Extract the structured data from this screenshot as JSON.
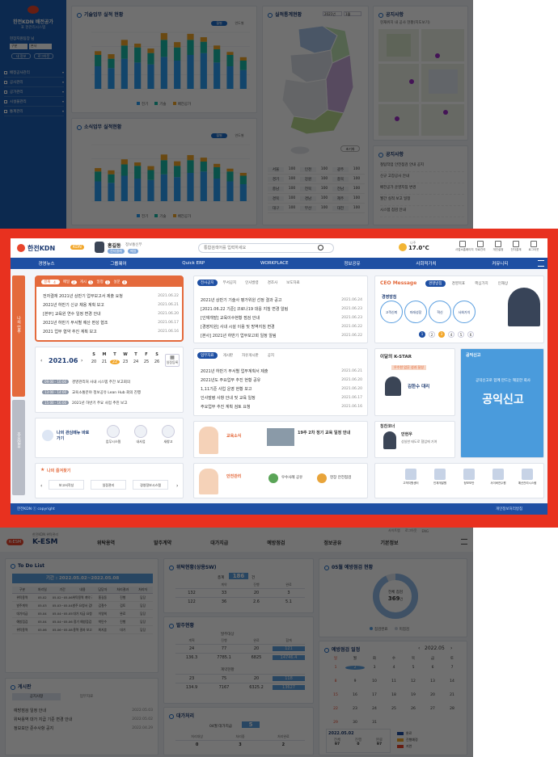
{
  "top": {
    "logo": "한전KDN 배전공가",
    "sub": "표 현관리시스템",
    "user": "현장지원팀장 님",
    "sel1": "구분",
    "sel2": "본사",
    "btn1": "내 정보",
    "btn2": "로그아웃",
    "menu": [
      "배정공사관리",
      "공사관리",
      "공가관리",
      "시설물관리",
      "통계관리"
    ],
    "chart1_title": "기술업무 실적 현황",
    "chart2_title": "소식업무 실적현황",
    "toggle_on": "월별",
    "toggle_off": "연도별",
    "legend": [
      "전기",
      "기술",
      "배전공가"
    ],
    "map_title": "실적통계현황",
    "map_year": "2021년",
    "map_month": "1월",
    "map_btn": "초기화",
    "map_table": [
      [
        "서울",
        "100",
        "인천",
        "100",
        "광주",
        "100"
      ],
      [
        "경기",
        "100",
        "강원",
        "100",
        "충북",
        "100"
      ],
      [
        "충남",
        "100",
        "전북",
        "100",
        "전남",
        "100"
      ],
      [
        "경북",
        "100",
        "경남",
        "100",
        "제주",
        "100"
      ],
      [
        "대구",
        "100",
        "부산",
        "100",
        "대전",
        "100"
      ]
    ],
    "loc_title": "공지사항",
    "loc_note": "현재위치 내 공사 현황(지도보기)",
    "notice_title": "공지사항",
    "notices": [
      "철탑작업 안전점검 안내 공지",
      "신규 고장공사 안내",
      "배전공가 운영지침 변경",
      "월간 실적 보고 일정",
      "시스템 점검 안내"
    ],
    "chart_data": [
      {
        "type": "bar",
        "title": "기술업무 실적 현황",
        "series": [
          {
            "name": "전기",
            "values": [
              60,
              55,
              80,
              70,
              65,
              85,
              75,
              90,
              95,
              70,
              60,
              50
            ]
          },
          {
            "name": "기술",
            "values": [
              30,
              25,
              35,
              40,
              30,
              45,
              35,
              40,
              30,
              35,
              30,
              25
            ]
          },
          {
            "name": "배전공가",
            "values": [
              10,
              12,
              15,
              10,
              12,
              18,
              14,
              16,
              12,
              10,
              8,
              9
            ]
          }
        ]
      },
      {
        "type": "bar",
        "title": "소식업무 실적현황",
        "series": [
          {
            "name": "전기",
            "values": [
              70,
              65,
              90,
              80,
              75,
              95,
              85,
              100,
              105,
              80,
              70,
              60
            ]
          },
          {
            "name": "기술",
            "values": [
              35,
              30,
              40,
              45,
              35,
              50,
              40,
              45,
              35,
              40,
              35,
              30
            ]
          },
          {
            "name": "배전공가",
            "values": [
              12,
              14,
              18,
              12,
              14,
              20,
              16,
              18,
              14,
              12,
              10,
              10
            ]
          }
        ]
      }
    ]
  },
  "portal": {
    "logo": "한전KDN",
    "logo_badge": "KDN",
    "user_name": "홍길동",
    "user_dept": "정보통신부",
    "user_tag1": "전자결재",
    "user_tag2": "메일",
    "search_placeholder": "통합검색어를 입력하세요",
    "weather_temp": "17.0℃",
    "weather_city": "나주",
    "tools": [
      "사업소홈페이지",
      "자료관리",
      "개인설정",
      "전자결재",
      "로그아웃"
    ],
    "nav": [
      "경영뉴스",
      "그룹웨어",
      "Quick ERP",
      "WORKPLACE",
      "정보공유",
      "사회적가치",
      "커뮤니티"
    ],
    "side_tabs": [
      "나의 업무",
      "주요업무"
    ],
    "mail_tabs": [
      "결재",
      "메일",
      "게시",
      "일정",
      "설문"
    ],
    "mail_counts": [
      "4",
      "2",
      "5",
      "1",
      "0"
    ],
    "mail_items": [
      {
        "t": "전자결재 2021년 상반기 업무보고서 제출 요청",
        "d": "2021.06.22"
      },
      {
        "t": "2021년 하반기 신규 채용 계획 보고",
        "d": "2021.06.21"
      },
      {
        "t": "[본부] 교육원 연수 일정 변경 안내",
        "d": "2021.06.20"
      },
      {
        "t": "2021년 하반기 부서별 예산 편성 협조",
        "d": "2021.06.17"
      },
      {
        "t": "2021 업무 협약 추진 계획 보고",
        "d": "2021.06.16"
      }
    ],
    "cal_month": "2021.06",
    "cal_days": [
      "S",
      "M",
      "T",
      "W",
      "T",
      "F",
      "S"
    ],
    "cal_dates": [
      "20",
      "21",
      "22",
      "23",
      "24",
      "25",
      "26"
    ],
    "cal_btn": "일정등록",
    "sched": [
      {
        "tag": "09:00 - 10:00",
        "t": "경영관리처 사내 시스템 주간 보고회의"
      },
      {
        "tag": "13:00 - 14:00",
        "t": "교육소통분야 정보공유 Lean Hub 회의 진행"
      },
      {
        "tag": "15:00 - 16:00",
        "t": "2021년 하반기 주요 사업 추진 보고"
      }
    ],
    "qm_title": "나의 관심메뉴 바로가기",
    "qm_items": [
      "업무시스템",
      "내사업",
      "새창고"
    ],
    "fav_title": "나의 즐겨찾기",
    "fav_items": [
      "보고서작성",
      "일정관리",
      "경영정보시스템"
    ],
    "news_tabs": [
      "전사공지",
      "부서공지",
      "인사발령",
      "경조사",
      "보도자료"
    ],
    "news_items": [
      {
        "t": "2021년 상반기 기술사 평가위원 선정 결과 공고",
        "d": "2021.06.24"
      },
      {
        "t": "[2021.06.22 기준] 코로나19 대응 지침 변경 알림",
        "d": "2021.06.23"
      },
      {
        "t": "[인재개발] 교육이수현황 점검 안내",
        "d": "2021.06.23"
      },
      {
        "t": "[경영지원] 사내 시설 이용 및 방역지침 변경",
        "d": "2021.06.22"
      },
      {
        "t": "[본사] 2021년 하반기 업무보고회 일정 알림",
        "d": "2021.06.22"
      }
    ],
    "news2_tabs": [
      "업무자료",
      "게시판",
      "자유게시판",
      "공지"
    ],
    "news2_items": [
      {
        "t": "2021년 하반기 부서별 업무계획서 제출",
        "d": "2021.06.21"
      },
      {
        "t": "2021년도 주요업무 추진 현황 공유",
        "d": "2021.06.20"
      },
      {
        "t": "1,11기준 사업 운영 현황 보고",
        "d": "2021.06.20"
      },
      {
        "t": "인사발령 사항 안내 및 교육 일정",
        "d": "2021.06.17"
      },
      {
        "t": "주요업무 추진 계획 검토 요청",
        "d": "2021.06.16"
      }
    ],
    "ceo_title": "CEO Message",
    "ceo_tabs": [
      "경영방침",
      "경영목표",
      "핵심가치",
      "인재상"
    ],
    "ceo_circles": [
      "고객신뢰",
      "미래성장",
      "혁신",
      "사회가치"
    ],
    "ceo_label": "경영방침",
    "ceo_pages": [
      "1",
      "2",
      "3",
      "4",
      "5",
      "6"
    ],
    "kstar_title": "이달의 K-STAR",
    "kstar_caption": "우수한 업무 성과 달성",
    "kstar_name": "김한수 대리",
    "pr_title": "칭찬코너",
    "pr_name": "안현우",
    "pr_text": "성실한 태도로 협업에 기여",
    "side_title": "공익신고",
    "side_sub": "공익신고로 함께 만드는 깨끗한 회사",
    "side_big": "공익신고",
    "banner1_label": "교육소식",
    "banner1_text": "19주 2차 정기 교육 일정 안내",
    "banner2_label": "안전관리",
    "banner2_items": [
      "우수사례 공유",
      "현장 안전점검"
    ],
    "bottom_icons": [
      "고객지원센터",
      "인재개발원",
      "정보보안",
      "사이버연수원",
      "예산관리시스템"
    ],
    "footer_left": "한전KDN ⓒ copyright",
    "footer_right": "개인정보처리방침"
  },
  "esm": {
    "brand": "K-ESM",
    "brand_sub": "한전KDN 위탁관리",
    "util": [
      "사이트맵",
      "로그아웃",
      "ENG"
    ],
    "nav": [
      "위탁용역",
      "발주계약",
      "대가지급",
      "예방점검",
      "정보공유",
      "기본정보"
    ],
    "todo_title": "To Do List",
    "todo_period": "기간 : 2022.05.02~2022.05.08",
    "todo_headers": [
      "구분",
      "처리일",
      "기간",
      "내용",
      "담당자",
      "처리결과",
      "처리자"
    ],
    "todo_rows": [
      [
        "위탁용역",
        "05.02",
        "05.02~05.06",
        "위탁용역 계약 검토",
        "홍길동",
        "진행",
        "담당"
      ],
      [
        "발주계약",
        "05.03",
        "05.03~05.04",
        "발주 요청서 검토",
        "김철수",
        "검토",
        "담당"
      ],
      [
        "대가지급",
        "05.04",
        "05.04~05.05",
        "대가 지급 요청",
        "이영희",
        "완료",
        "담당"
      ],
      [
        "예방점검",
        "05.04",
        "05.04~05.06",
        "정기 예방점검",
        "박민수",
        "진행",
        "담당"
      ],
      [
        "위탁용역",
        "05.06",
        "05.06~05.08",
        "용역 결과 보고",
        "최지훈",
        "대기",
        "담당"
      ]
    ],
    "board_title": "게시판",
    "board_tabs": [
      "공지사항",
      "업무자료"
    ],
    "board_items": [
      {
        "t": "예방점검 일정 안내",
        "d": "2022.05.03"
      },
      {
        "t": "위탁용역 대가 지급 기준 변경 안내",
        "d": "2022.05.02"
      },
      {
        "t": "정보보안 준수사항 공지",
        "d": "2022.04.29"
      }
    ],
    "status_title": "위탁현황(상용SW)",
    "status_total_label": "총계",
    "status_total": "186",
    "status_unit": "건",
    "status_heads": [
      "계약",
      "진행",
      "완료"
    ],
    "status_r1": [
      "132",
      "33",
      "20",
      "3"
    ],
    "status_r2": [
      "122",
      "36",
      "2.6",
      "5.1"
    ],
    "order_title": "발주현황",
    "order_sub1": "발주대상",
    "order_heads1": [
      "계획",
      "진행",
      "완료",
      "합계"
    ],
    "order_r1": [
      "24",
      "77",
      "20",
      "121"
    ],
    "order_r2": [
      "136.3",
      "7785.1",
      "6825",
      "14746.4"
    ],
    "order_sub2": "계약현황",
    "order_r3": [
      "23",
      "75",
      "20",
      "118"
    ],
    "order_r4": [
      "134.9",
      "7167",
      "6325.2",
      "13627"
    ],
    "pay_title": "대가처리",
    "pay_label": "04월 대가지급",
    "pay_value": "5",
    "pay_heads": [
      "처리대상",
      "처리중",
      "처리완료"
    ],
    "pay_r": [
      "0",
      "3",
      "2"
    ],
    "prev_title": "05월 예방점검 현황",
    "prev_center_label": "전체 점검",
    "prev_center": "369",
    "prev_unit": "건",
    "prev_legend": [
      "점검완료",
      "미점검"
    ],
    "sched_title": "예방점검 일정",
    "sched_month": "2022.05",
    "sched_days": [
      "일",
      "월",
      "화",
      "수",
      "목",
      "금",
      "토"
    ],
    "sched_weeks": [
      [
        "1",
        "2",
        "3",
        "4",
        "5",
        "6",
        "7"
      ],
      [
        "8",
        "9",
        "10",
        "11",
        "12",
        "13",
        "14"
      ],
      [
        "15",
        "16",
        "17",
        "18",
        "19",
        "20",
        "21"
      ],
      [
        "22",
        "23",
        "24",
        "25",
        "26",
        "27",
        "28"
      ],
      [
        "29",
        "30",
        "31",
        "",
        "",
        "",
        ""
      ]
    ],
    "sched_foot_date": "2022.05.02",
    "sched_foot_vals": [
      "97",
      "0",
      "97"
    ],
    "sched_foot_heads": [
      "전체",
      "진행",
      "완료"
    ],
    "sched_legend": [
      "완료",
      "진행예정",
      "지연"
    ]
  }
}
